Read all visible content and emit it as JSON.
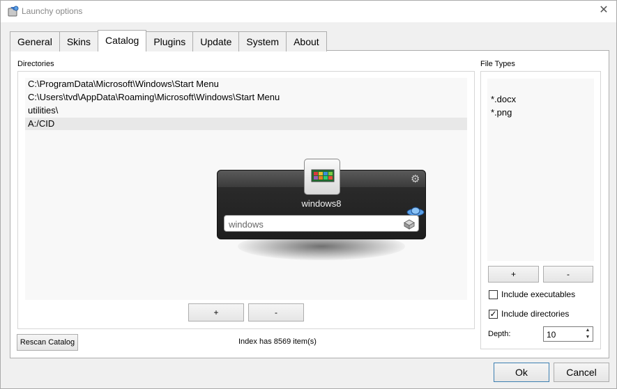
{
  "window": {
    "title": "Launchy options",
    "close_glyph": "✕",
    "icon": "launchy-app-icon"
  },
  "tabs": [
    {
      "label": "General",
      "active": false
    },
    {
      "label": "Skins",
      "active": false
    },
    {
      "label": "Catalog",
      "active": true
    },
    {
      "label": "Plugins",
      "active": false
    },
    {
      "label": "Update",
      "active": false
    },
    {
      "label": "System",
      "active": false
    },
    {
      "label": "About",
      "active": false
    }
  ],
  "directories": {
    "label": "Directories",
    "items": [
      {
        "path": "C:\\ProgramData\\Microsoft\\Windows\\Start Menu",
        "selected": false
      },
      {
        "path": "C:\\Users\\tvd\\AppData\\Roaming\\Microsoft\\Windows\\Start Menu",
        "selected": false
      },
      {
        "path": "utilities\\",
        "selected": false
      },
      {
        "path": "A:/CID",
        "selected": true
      }
    ],
    "add_label": "+",
    "remove_label": "-"
  },
  "file_types": {
    "label": "File Types",
    "items": [
      "*.docx",
      "*.png"
    ],
    "add_label": "+",
    "remove_label": "-"
  },
  "options": {
    "include_executables": {
      "label": "Include executables",
      "checked": false
    },
    "include_directories": {
      "label": "Include directories",
      "checked": true
    },
    "check_glyph": "✓",
    "depth_label": "Depth:",
    "depth_value": "10",
    "spin_up": "▲",
    "spin_down": "▼"
  },
  "rescan_label": "Rescan Catalog",
  "index_status": "Index has 8569 item(s)",
  "launchy": {
    "result_label": "windows8",
    "input_text": "windows",
    "gear_glyph": "⚙"
  },
  "footer": {
    "ok_label": "Ok",
    "cancel_label": "Cancel"
  },
  "colors": {
    "selection": "#e8e8e8",
    "launchy_bg": "#1e1e1e"
  }
}
